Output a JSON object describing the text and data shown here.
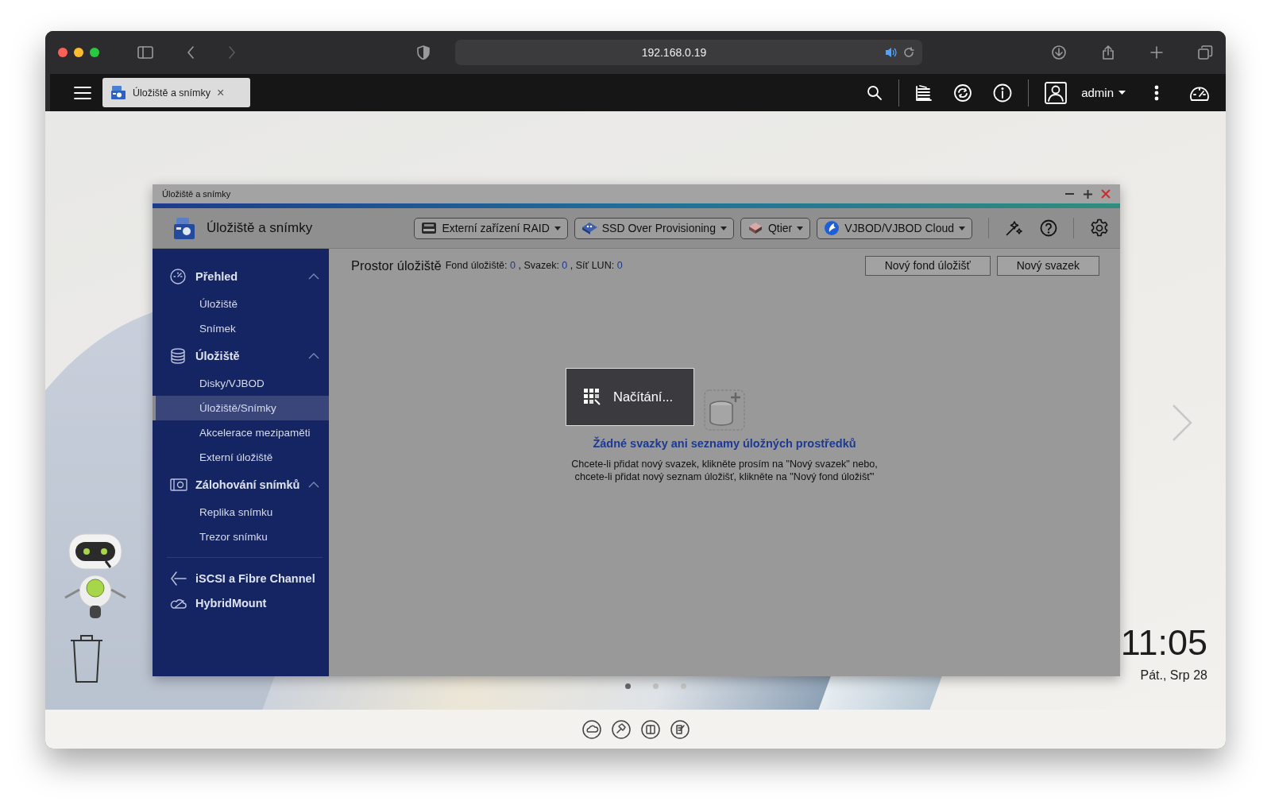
{
  "browser": {
    "address": "192.168.0.19"
  },
  "nas_bar": {
    "tab_title": "Úložiště a snímky",
    "tab_close": "×",
    "user": "admin"
  },
  "app_window": {
    "title": "Úložiště a snímky",
    "app_name": "Úložiště a snímky",
    "toolbar_buttons": [
      {
        "label": "Externí zařízení RAID"
      },
      {
        "label": "SSD Over Provisioning"
      },
      {
        "label": "Qtier"
      },
      {
        "label": "VJBOD/VJBOD Cloud"
      }
    ],
    "sidebar": {
      "sections": [
        {
          "label": "Přehled",
          "expanded": true,
          "children": [
            {
              "label": "Úložiště",
              "selected": false
            },
            {
              "label": "Snímek",
              "selected": false
            }
          ]
        },
        {
          "label": "Úložiště",
          "expanded": true,
          "children": [
            {
              "label": "Disky/VJBOD",
              "selected": false
            },
            {
              "label": "Úložiště/Snímky",
              "selected": true
            },
            {
              "label": "Akcelerace mezipaměti",
              "selected": false
            },
            {
              "label": "Externí úložiště",
              "selected": false
            }
          ]
        },
        {
          "label": "Zálohování snímků",
          "expanded": true,
          "children": [
            {
              "label": "Replika snímku",
              "selected": false
            },
            {
              "label": "Trezor snímku",
              "selected": false
            }
          ]
        }
      ],
      "links": [
        {
          "label": "iSCSI a Fibre Channel"
        },
        {
          "label": "HybridMount"
        }
      ]
    },
    "header": {
      "title": "Prostor úložiště",
      "stats": [
        {
          "label": "Fond úložiště:",
          "value": "0"
        },
        {
          "label": ", Svazek:",
          "value": "0"
        },
        {
          "label": ", Síť LUN:",
          "value": "0"
        }
      ]
    },
    "buttons": [
      "Nový fond úložišť",
      "Nový svazek"
    ],
    "empty_state": {
      "heading": "Žádné svazky ani seznamy úložných prostředků",
      "description": "Chcete-li přidat nový svazek, klikněte prosím na \"Nový svazek\" nebo, chcete-li přidat nový seznam úložišť, klikněte na \"Nový fond úložišť\""
    },
    "loading": {
      "text": "Načítání..."
    }
  },
  "desktop": {
    "time": "11:05",
    "date": "Pát., Srp 28",
    "pages": [
      {
        "selected": true
      },
      {
        "selected": false
      },
      {
        "selected": false
      }
    ]
  }
}
